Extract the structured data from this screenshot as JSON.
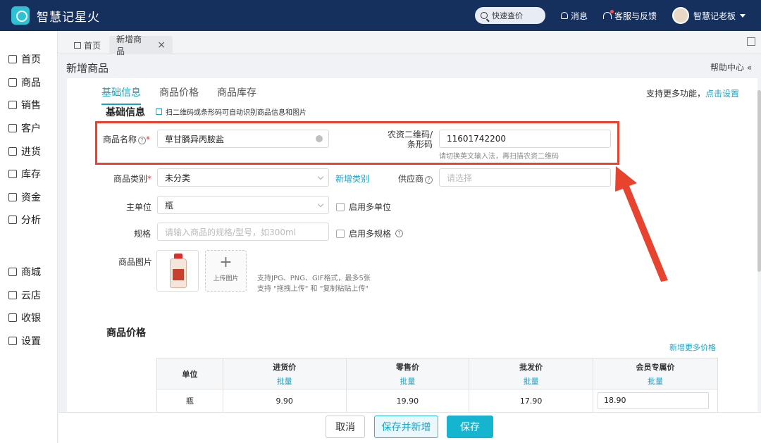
{
  "app": {
    "title": "智慧记星火",
    "quick_search": "快速查价",
    "messages": "消息",
    "support": "客服与反馈",
    "user": "智慧记老板"
  },
  "sidebar": {
    "items": [
      {
        "label": "首页",
        "icon": "home-icon"
      },
      {
        "label": "商品",
        "icon": "goods-icon"
      },
      {
        "label": "销售",
        "icon": "sales-icon"
      },
      {
        "label": "客户",
        "icon": "customer-icon"
      },
      {
        "label": "进货",
        "icon": "purchase-icon"
      },
      {
        "label": "库存",
        "icon": "stock-icon"
      },
      {
        "label": "资金",
        "icon": "fund-icon"
      },
      {
        "label": "分析",
        "icon": "analysis-icon"
      }
    ],
    "items2": [
      {
        "label": "商城",
        "icon": "mall-icon"
      },
      {
        "label": "云店",
        "icon": "cloud-store-icon"
      },
      {
        "label": "收银",
        "icon": "cashier-icon"
      },
      {
        "label": "设置",
        "icon": "settings-icon"
      }
    ]
  },
  "tabs": {
    "home": "首页",
    "active": "新增商品",
    "close": "×"
  },
  "page": {
    "title": "新增商品",
    "help": "帮助中心 «"
  },
  "sub_tabs": [
    "基础信息",
    "商品价格",
    "商品库存"
  ],
  "more_func": {
    "text": "支持更多功能，",
    "link": "点击设置"
  },
  "basic": {
    "section_title": "基础信息",
    "scan_hint": "扫二维码或条形码可自动识别商品信息和图片",
    "name_label": "商品名称",
    "name_value": "草甘膦异丙胺盐",
    "code_label_1": "农资二维码/",
    "code_label_2": "条形码",
    "code_value": "11601742200",
    "code_hint": "请切换英文输入法，再扫描农资二维码",
    "category_label": "商品类别",
    "category_value": "未分类",
    "add_category": "新增类别",
    "supplier_label": "供应商",
    "supplier_placeholder": "请选择",
    "unit_label": "主单位",
    "unit_value": "瓶",
    "multi_unit": "启用多单位",
    "spec_label": "规格",
    "spec_placeholder": "请输入商品的规格/型号，如300ml",
    "multi_spec": "启用多规格",
    "image_label": "商品图片",
    "upload_label": "上传图片",
    "upload_plus": "+",
    "image_hint_1": "支持JPG、PNG、GIF格式，最多5张",
    "image_hint_2": "支持 \"拖拽上传\" 和 \"复制粘贴上传\"",
    "required_mark": "*",
    "help_mark": "?"
  },
  "price": {
    "section_title": "商品价格",
    "add_more": "新增更多价格",
    "headers": [
      "单位",
      "进货价",
      "零售价",
      "批发价",
      "会员专属价"
    ],
    "batch": "批量",
    "row": {
      "unit": "瓶",
      "purchase": "9.90",
      "retail": "19.90",
      "wholesale": "17.90",
      "member": "18.90"
    }
  },
  "actions": {
    "cancel": "取消",
    "save_new": "保存并新增",
    "save": "保存"
  },
  "colors": {
    "topbar": "#16305e",
    "accent": "#16b5cf",
    "link": "#1aa5c9",
    "highlight": "#e8432f"
  }
}
